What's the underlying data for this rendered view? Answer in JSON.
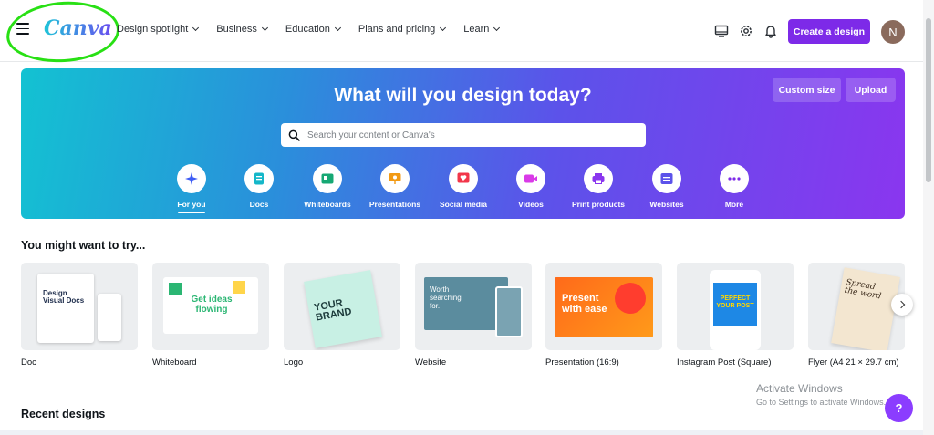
{
  "header": {
    "logo": "Canva",
    "nav": [
      {
        "label": "Design spotlight"
      },
      {
        "label": "Business"
      },
      {
        "label": "Education"
      },
      {
        "label": "Plans and pricing"
      },
      {
        "label": "Learn"
      }
    ],
    "create_button": "Create a design",
    "avatar_initial": "N"
  },
  "hero": {
    "title": "What will you design today?",
    "custom_size": "Custom size",
    "upload": "Upload",
    "search_placeholder": "Search your content or Canva's",
    "categories": [
      {
        "label": "For you",
        "icon": "sparkle-icon",
        "color": "#3d5cf5"
      },
      {
        "label": "Docs",
        "icon": "doc-icon",
        "color": "#14b7c9"
      },
      {
        "label": "Whiteboards",
        "icon": "whiteboard-icon",
        "color": "#16a874"
      },
      {
        "label": "Presentations",
        "icon": "presentation-icon",
        "color": "#f29a14"
      },
      {
        "label": "Social media",
        "icon": "heart-icon",
        "color": "#f2364a"
      },
      {
        "label": "Videos",
        "icon": "video-icon",
        "color": "#d93ae8"
      },
      {
        "label": "Print products",
        "icon": "printer-icon",
        "color": "#8a36ef"
      },
      {
        "label": "Websites",
        "icon": "website-icon",
        "color": "#5c52ea"
      },
      {
        "label": "More",
        "icon": "more-icon",
        "color": "#7d2ae8"
      }
    ]
  },
  "try_section": {
    "title": "You might want to try...",
    "cards": [
      {
        "label": "Doc",
        "thumb_text": "Design Visual Docs"
      },
      {
        "label": "Whiteboard",
        "thumb_text": "Get ideas flowing"
      },
      {
        "label": "Logo",
        "thumb_text": "YOUR BRAND"
      },
      {
        "label": "Website",
        "thumb_text": "Worth searching for."
      },
      {
        "label": "Presentation (16:9)",
        "thumb_text": "Present with ease"
      },
      {
        "label": "Instagram Post (Square)",
        "thumb_text": "PERFECT YOUR POST"
      },
      {
        "label": "Flyer (A4 21 × 29.7 cm)",
        "thumb_text": "Spread the word"
      }
    ]
  },
  "recent": {
    "title": "Recent designs"
  },
  "overlay": {
    "watermark_title": "Activate Windows",
    "watermark_sub": "Go to Settings to activate Windows.",
    "help": "?"
  }
}
